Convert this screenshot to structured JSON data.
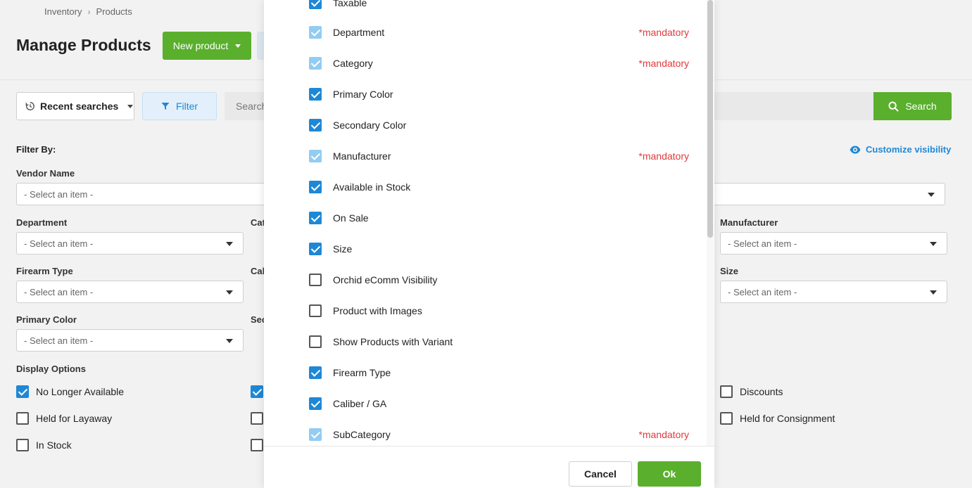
{
  "breadcrumb": {
    "items": [
      "Inventory",
      "Products"
    ],
    "separator": "›"
  },
  "page": {
    "title": "Manage Products"
  },
  "toolbar": {
    "new_product_label": "New product"
  },
  "search": {
    "recent_label": "Recent searches",
    "filter_label": "Filter",
    "placeholder": "Search",
    "search_label": "Search"
  },
  "filters": {
    "title": "Filter By:",
    "customize_label": "Customize visibility",
    "select_placeholder": "- Select an item -",
    "vendor_name": "Vendor Name",
    "department": "Department",
    "category_partial": "Cat",
    "manufacturer": "Manufacturer",
    "firearm_type": "Firearm Type",
    "caliber_partial": "Cal",
    "size": "Size",
    "primary_color": "Primary Color",
    "secondary_partial": "Sec"
  },
  "display_options": {
    "title": "Display Options",
    "items": [
      {
        "label": "No Longer Available",
        "checked": true
      },
      {
        "label": "Held for Layaway",
        "checked": false
      },
      {
        "label": "In Stock",
        "checked": false
      },
      {
        "label": "Discounts",
        "checked": false
      },
      {
        "label": "Held for Consignment",
        "checked": false
      }
    ]
  },
  "modal": {
    "mandatory_label": "*mandatory",
    "items": [
      {
        "label": "Taxable",
        "state": "checked",
        "mandatory": false
      },
      {
        "label": "Department",
        "state": "locked",
        "mandatory": true
      },
      {
        "label": "Category",
        "state": "locked",
        "mandatory": true
      },
      {
        "label": "Primary Color",
        "state": "checked",
        "mandatory": false
      },
      {
        "label": "Secondary Color",
        "state": "checked",
        "mandatory": false
      },
      {
        "label": "Manufacturer",
        "state": "locked",
        "mandatory": true
      },
      {
        "label": "Available in Stock",
        "state": "checked",
        "mandatory": false
      },
      {
        "label": "On Sale",
        "state": "checked",
        "mandatory": false
      },
      {
        "label": "Size",
        "state": "checked",
        "mandatory": false
      },
      {
        "label": "Orchid eComm Visibility",
        "state": "unchecked",
        "mandatory": false
      },
      {
        "label": "Product with Images",
        "state": "unchecked",
        "mandatory": false
      },
      {
        "label": "Show Products with Variant",
        "state": "unchecked",
        "mandatory": false
      },
      {
        "label": "Firearm Type",
        "state": "checked",
        "mandatory": false
      },
      {
        "label": "Caliber / GA",
        "state": "checked",
        "mandatory": false
      },
      {
        "label": "SubCategory",
        "state": "locked",
        "mandatory": true
      }
    ],
    "cancel_label": "Cancel",
    "ok_label": "Ok"
  },
  "colors": {
    "accent": "#1e88d6",
    "primary_green": "#5aaf2d",
    "mandatory_red": "#e2393b"
  }
}
